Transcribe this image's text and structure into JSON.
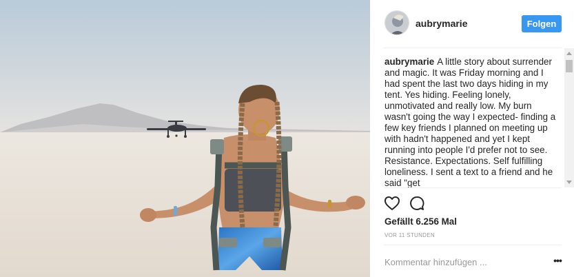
{
  "post": {
    "username": "aubrymarie",
    "follow_label": "Folgen",
    "caption_user": "aubrymarie",
    "caption_text": "A little story about surrender and magic. It was Friday morning and I had spent the last two days hiding in my tent. Yes hiding. Feeling lonely, unmotivated and really low. My burn wasn't going the way I expected- finding a few key friends I planned on meeting up with hadn't happened and yet I kept running into people I'd prefer not to see. Resistance. Expectations. Self fulfilling loneliness. I sent a text to a friend and he said \"get",
    "likes": "Gefällt 6.256 Mal",
    "timestamp": "VOR 11 STUNDEN",
    "comment_placeholder": "Kommentar hinzufügen ...",
    "more_label": "•••"
  },
  "icons": {
    "like": "heart-icon",
    "comment": "speech-bubble-icon",
    "more": "more-options-icon"
  },
  "colors": {
    "follow_button": "#3897f0",
    "text": "#262626",
    "muted": "#999999"
  }
}
